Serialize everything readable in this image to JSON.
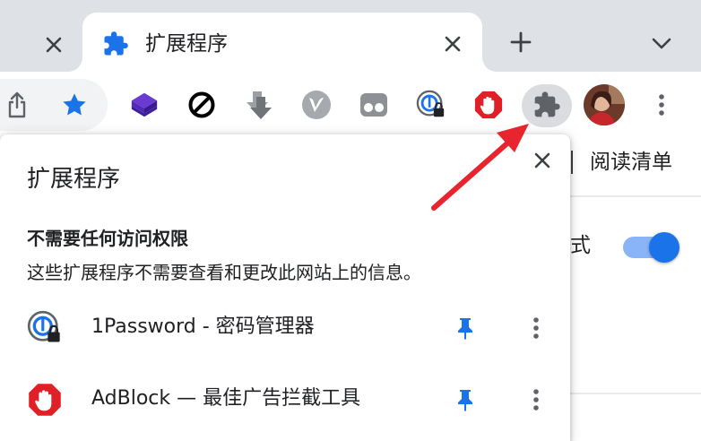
{
  "tabs": {
    "active_title": "扩展程序",
    "icons": [
      "close-icon",
      "puzzle-icon",
      "plus-icon",
      "chevron-down-icon"
    ]
  },
  "toolbar": {
    "extensions": [
      "share-icon",
      "bookmark-star-icon",
      "layers-icon",
      "blocked-icon",
      "download-arrow-icon",
      "v-logo-icon",
      "tab-dots-icon",
      "1password-icon",
      "adblock-icon",
      "puzzle-icon",
      "avatar",
      "kebab-menu-icon"
    ]
  },
  "background": {
    "reading_list": "阅读清单",
    "mode_label": "式"
  },
  "popup": {
    "title": "扩展程序",
    "section_title": "不需要任何访问权限",
    "section_desc": "这些扩展程序不需要查看和更改此网站上的信息。",
    "extensions": [
      {
        "name": "1Password - 密码管理器",
        "icon": "1password-icon",
        "pinned": true
      },
      {
        "name": "AdBlock — 最佳广告拦截工具",
        "icon": "adblock-icon",
        "pinned": true
      }
    ]
  },
  "colors": {
    "accent": "#1a73e8",
    "tabstrip": "#dee1e6",
    "arrow": "#e8242f",
    "adblock": "#e01f26"
  }
}
